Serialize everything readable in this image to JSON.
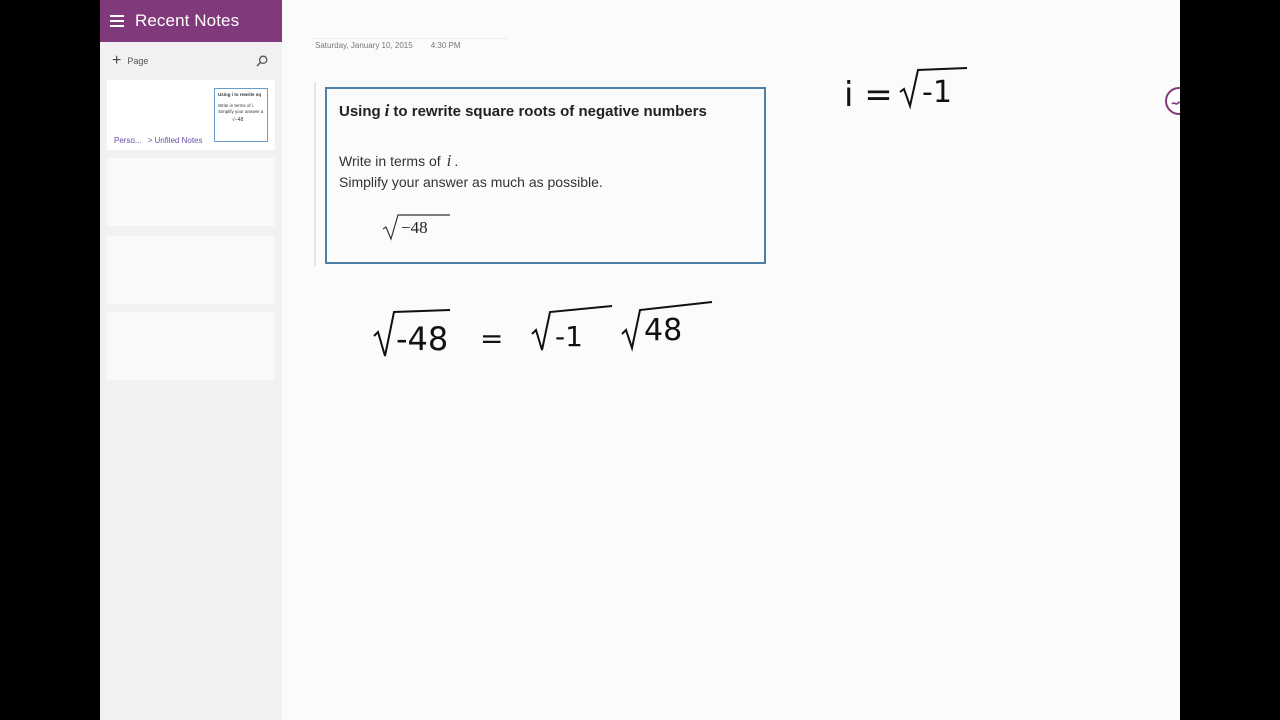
{
  "sidebar": {
    "title": "Recent Notes",
    "add_page_label": "Page",
    "pages": [
      {
        "thumb_title": "Using i to rewrite sq",
        "thumb_line1": "Write in terms of i.",
        "thumb_line2": "Simplify your answer a",
        "thumb_expr": "√−48",
        "notebook": "Perso...",
        "section": "> Unfiled Notes"
      }
    ]
  },
  "page": {
    "date": "Saturday, January 10, 2015",
    "time": "4:30 PM"
  },
  "problem": {
    "title_prefix": "Using",
    "title_var": "i",
    "title_suffix": "to rewrite square roots of negative numbers",
    "line1_prefix": "Write in terms of",
    "line1_var": "i",
    "line1_suffix": ".",
    "line2": "Simplify your answer as much as possible.",
    "radicand": "−48"
  },
  "ink": {
    "definition_left": "i =",
    "definition_radicand": "-1",
    "work_radicand1": "-48",
    "work_radicand2": "-1",
    "work_radicand3": "48"
  },
  "colors": {
    "accent": "#80397b",
    "box_border": "#4e7fa9",
    "link": "#6a4ea3"
  },
  "icons": [
    "hamburger-icon",
    "plus-icon",
    "search-icon",
    "pen-icon"
  ]
}
